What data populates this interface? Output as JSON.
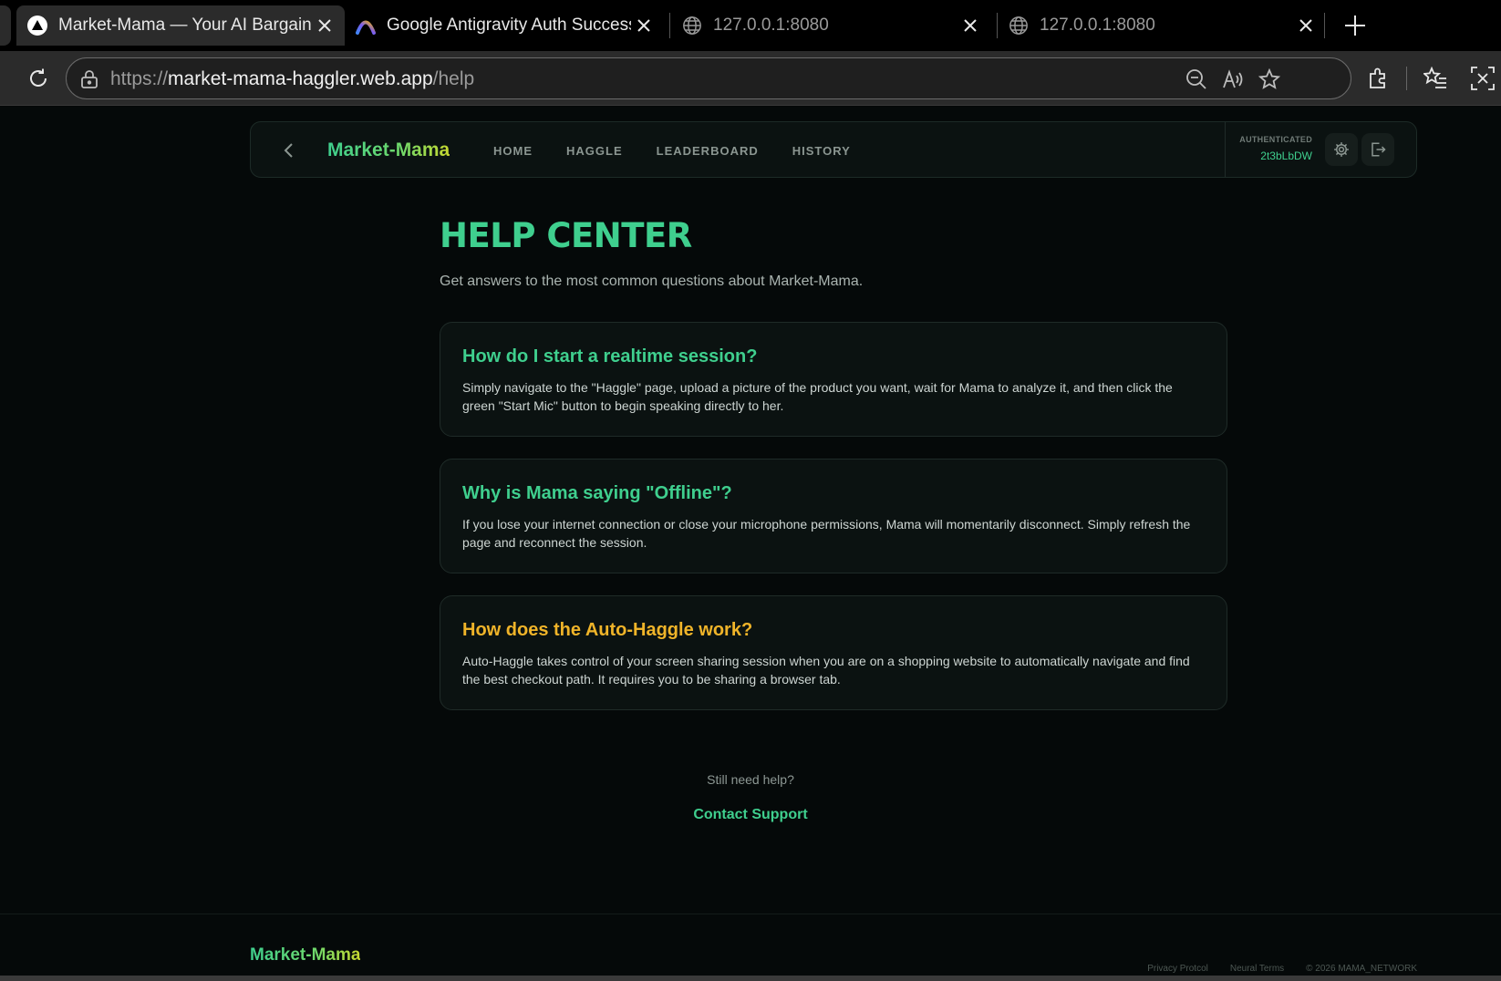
{
  "browser": {
    "tabs": [
      {
        "title": "Market-Mama — Your AI Bargaining Assistant",
        "active": true,
        "icon": "triangle-logo-icon"
      },
      {
        "title": "Google Antigravity Auth Success",
        "active": false,
        "icon": "antigravity-logo-icon"
      },
      {
        "title": "127.0.0.1:8080",
        "active": false,
        "icon": "globe-icon"
      },
      {
        "title": "127.0.0.1:8080",
        "active": false,
        "icon": "globe-icon"
      }
    ],
    "url": {
      "scheme": "https://",
      "host": "market-mama-haggler.web.app",
      "path": "/help"
    }
  },
  "nav": {
    "brand": "Market-Mama",
    "links": [
      "HOME",
      "HAGGLE",
      "LEADERBOARD",
      "HISTORY"
    ],
    "auth_label": "AUTHENTICATED",
    "auth_id": "2t3bLbDW"
  },
  "help": {
    "title": "HELP CENTER",
    "subtitle": "Get answers to the most common questions about Market-Mama.",
    "faqs": [
      {
        "question": "How do I start a realtime session?",
        "answer": "Simply navigate to the \"Haggle\" page, upload a picture of the product you want, wait for Mama to analyze it, and then click the green \"Start Mic\" button to begin speaking directly to her."
      },
      {
        "question": "Why is Mama saying \"Offline\"?",
        "answer": "If you lose your internet connection or close your microphone permissions, Mama will momentarily disconnect. Simply refresh the page and reconnect the session."
      },
      {
        "question": "How does the Auto-Haggle work?",
        "answer": "Auto-Haggle takes control of your screen sharing session when you are on a shopping website to automatically navigate and find the best checkout path. It requires you to be sharing a browser tab."
      }
    ],
    "still_need_help": "Still need help?",
    "contact_label": "Contact Support"
  },
  "footer": {
    "brand": "Market-Mama",
    "links": [
      "Privacy Protcol",
      "Neural Terms",
      "© 2026 MAMA_NETWORK"
    ]
  },
  "colors": {
    "accent": "#3fcf8e",
    "amber": "#f0b429",
    "background": "#050909",
    "card": "#0b1211"
  }
}
